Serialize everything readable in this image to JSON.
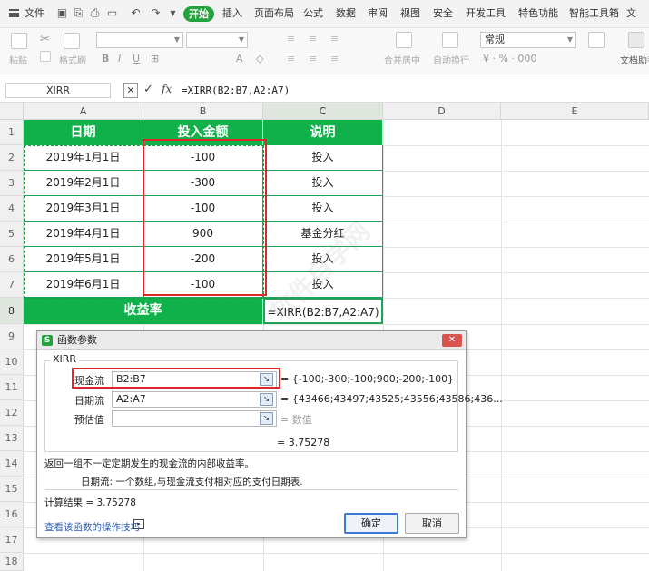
{
  "menubar": {
    "file_label": "文件",
    "start_label": "开始",
    "tabs": [
      "插入",
      "页面布局",
      "公式",
      "数据",
      "审阅",
      "视图",
      "安全",
      "开发工具",
      "特色功能",
      "智能工具箱",
      "文"
    ]
  },
  "toolbar": {
    "paste_label": "粘贴",
    "format_painter_label": "格式刷",
    "merge_label": "合并居中",
    "wrap_label": "自动换行",
    "number_format_value": "常规",
    "assistant_label": "文档助手"
  },
  "formula_bar": {
    "name_box": "XIRR",
    "fx_label": "fx",
    "formula": "=XIRR(B2:B7,A2:A7)"
  },
  "columns": [
    "A",
    "B",
    "C",
    "D",
    "E"
  ],
  "rows": [
    "1",
    "2",
    "3",
    "4",
    "5",
    "6",
    "7",
    "8",
    "9",
    "10",
    "11",
    "12",
    "13",
    "14",
    "15",
    "16",
    "17",
    "18"
  ],
  "table": {
    "headers": [
      "日期",
      "投入金额",
      "说明"
    ],
    "rows": [
      [
        "2019年1月1日",
        "-100",
        "投入"
      ],
      [
        "2019年2月1日",
        "-300",
        "投入"
      ],
      [
        "2019年3月1日",
        "-100",
        "投入"
      ],
      [
        "2019年4月1日",
        "900",
        "基金分红"
      ],
      [
        "2019年5月1日",
        "-200",
        "投入"
      ],
      [
        "2019年6月1日",
        "-100",
        "投入"
      ]
    ],
    "total_label": "收益率",
    "total_formula": "=XIRR(B2:B7,A2:A7)"
  },
  "dialog": {
    "title": "函数参数",
    "function_name": "XIRR",
    "params": [
      {
        "label": "现金流",
        "value": "B2:B7",
        "result": "= {-100;-300;-100;900;-200;-100}"
      },
      {
        "label": "日期流",
        "value": "A2:A7",
        "result": "= {43466;43497;43525;43556;43586;436..."
      },
      {
        "label": "预估值",
        "value": "",
        "result": "= 数值"
      }
    ],
    "result_line": "= 3.75278",
    "description": "返回一组不一定定期发生的现金流的内部收益率。",
    "param_help": "日期流:    一个数组,与现金流支付相对应的支付日期表.",
    "calc_result": "计算结果 =  3.75278",
    "help_link": "查看该函数的操作技巧",
    "ok_label": "确定",
    "cancel_label": "取消"
  },
  "watermark": "软件自学网"
}
